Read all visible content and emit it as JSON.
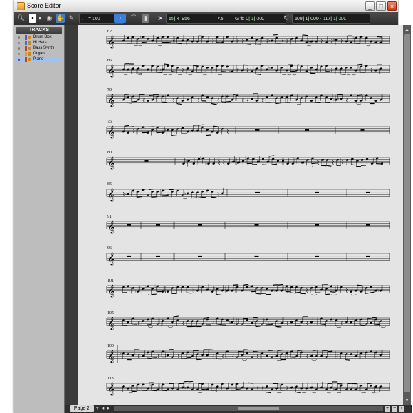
{
  "window": {
    "title": "Score Editor"
  },
  "title_buttons": {
    "minimize": "_",
    "maximize": "□",
    "close": "×"
  },
  "toolbar": {
    "tempo": "♩ = 100",
    "position": "65| 4| 956",
    "key": "A5",
    "grid_label": "Grid",
    "grid_value": "0| 1| 000",
    "loop_start": "109| 1| 000",
    "loop_sep": "-",
    "loop_end": "117| 1| 000"
  },
  "sidebar": {
    "header": "TRACKS",
    "tracks": [
      {
        "name": "Drum Box"
      },
      {
        "name": "Hi Hats"
      },
      {
        "name": "Bass Synth"
      },
      {
        "name": "Organ"
      },
      {
        "name": "Piano"
      }
    ]
  },
  "score": {
    "systems": [
      {
        "measure": "62",
        "pattern": "A"
      },
      {
        "measure": "66",
        "pattern": "B"
      },
      {
        "measure": "70",
        "pattern": "C"
      },
      {
        "measure": "75",
        "pattern": "D"
      },
      {
        "measure": "80",
        "pattern": "E"
      },
      {
        "measure": "85",
        "pattern": "F"
      },
      {
        "measure": "91",
        "pattern": "R"
      },
      {
        "measure": "96",
        "pattern": "R"
      },
      {
        "measure": "101",
        "pattern": "C"
      },
      {
        "measure": "105",
        "pattern": "B"
      },
      {
        "measure": "109",
        "pattern": "C"
      },
      {
        "measure": "113",
        "pattern": "B"
      }
    ]
  },
  "footer": {
    "page_label": "Page 2"
  },
  "colors": {
    "score_bg": "#e4e4e4",
    "staff_line": "#111111",
    "cursor": "#3355cc",
    "chrome_dark": "#3a3a3a",
    "selected_track": "#9ec3ee"
  }
}
